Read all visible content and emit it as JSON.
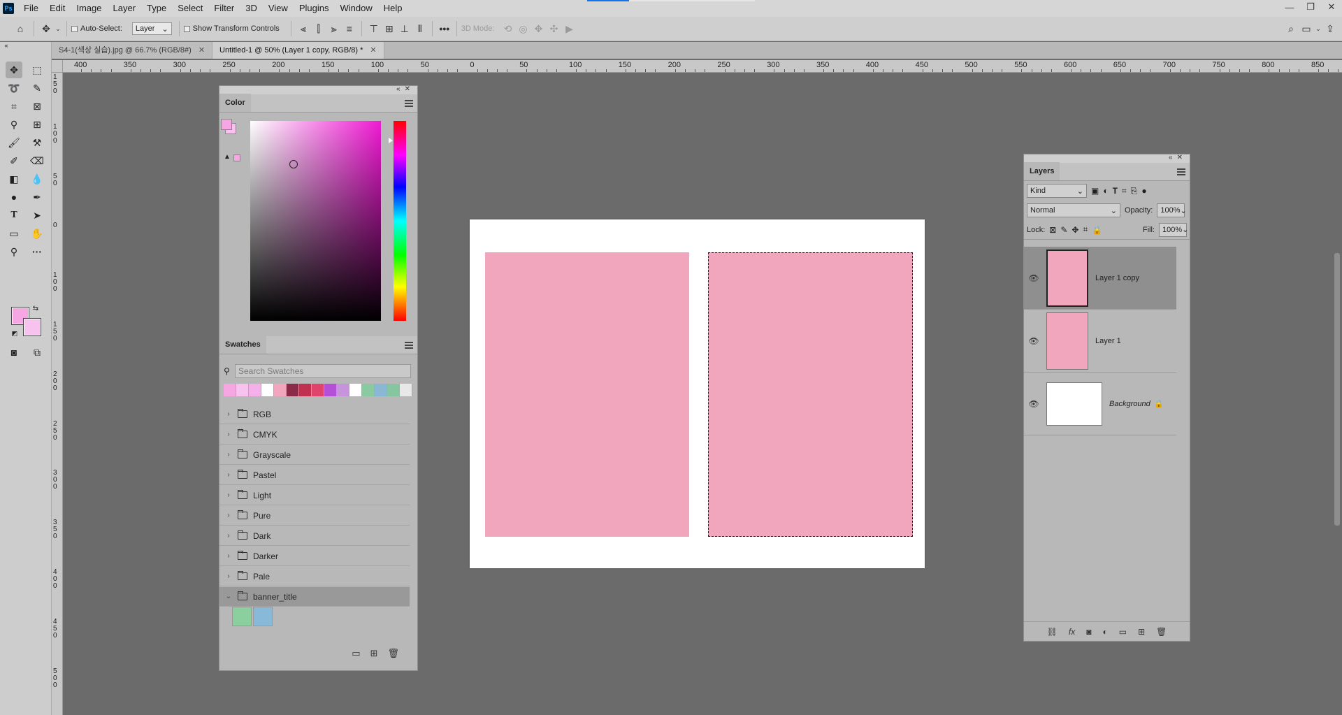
{
  "menu": {
    "logo": "Ps",
    "items": [
      "File",
      "Edit",
      "Image",
      "Layer",
      "Type",
      "Select",
      "Filter",
      "3D",
      "View",
      "Plugins",
      "Window",
      "Help"
    ]
  },
  "options": {
    "auto_select_label": "Auto-Select:",
    "auto_select_target": "Layer",
    "transform_controls_label": "Show Transform Controls",
    "mode_3d_label": "3D Mode:"
  },
  "tabs": [
    {
      "label": "S4-1(색상 실습).jpg @ 66.7% (RGB/8#)",
      "active": false
    },
    {
      "label": "Untitled-1 @ 50% (Layer 1 copy, RGB/8) *",
      "active": true
    }
  ],
  "ruler": {
    "h_ticks": [
      "400",
      "350",
      "300",
      "250",
      "200",
      "150",
      "100",
      "50",
      "0",
      "50",
      "100",
      "150",
      "200",
      "250",
      "300",
      "350",
      "400",
      "450",
      "500",
      "550",
      "600",
      "650",
      "700",
      "750",
      "800",
      "850"
    ],
    "v_ticks": [
      "150",
      "100",
      "50",
      "0",
      "100",
      "150",
      "200",
      "250",
      "300",
      "350",
      "400",
      "450",
      "500"
    ]
  },
  "color_panel": {
    "title": "Color",
    "foreground": "#f6a6e2",
    "background": "#f7c2ee",
    "warning_swatch": "#f6a6e2"
  },
  "swatches_panel": {
    "title": "Swatches",
    "search_placeholder": "Search Swatches",
    "recent": [
      "#f6a6e2",
      "#f7c2ee",
      "#f4b0e8",
      "#ffffff",
      "#f1a6bd",
      "#8b2b4a",
      "#c0304f",
      "#e0446d",
      "#b44fd8",
      "#c594da",
      "#ffffff",
      "#8bc9a0",
      "#8ab8d4",
      "#85c5a0",
      "#e8e8e8"
    ],
    "folders": [
      "RGB",
      "CMYK",
      "Grayscale",
      "Pastel",
      "Light",
      "Pure",
      "Dark",
      "Darker",
      "Pale",
      "banner_title"
    ],
    "open_folder_swatches": [
      "#8ccf9e",
      "#88b9d8"
    ]
  },
  "layers_panel": {
    "title": "Layers",
    "filter_kind": "Kind",
    "blend_mode": "Normal",
    "opacity_label": "Opacity:",
    "opacity_value": "100%",
    "lock_label": "Lock:",
    "fill_label": "Fill:",
    "fill_value": "100%",
    "layers": [
      {
        "name": "Layer 1 copy",
        "color": "#f1a6bd",
        "selected": true,
        "locked": false
      },
      {
        "name": "Layer 1",
        "color": "#f1a6bd",
        "selected": false,
        "locked": false
      },
      {
        "name": "Background",
        "color": "#ffffff",
        "selected": false,
        "locked": true
      }
    ]
  },
  "canvas": {
    "background": "#ffffff",
    "shape_color": "#f1a6bd"
  }
}
